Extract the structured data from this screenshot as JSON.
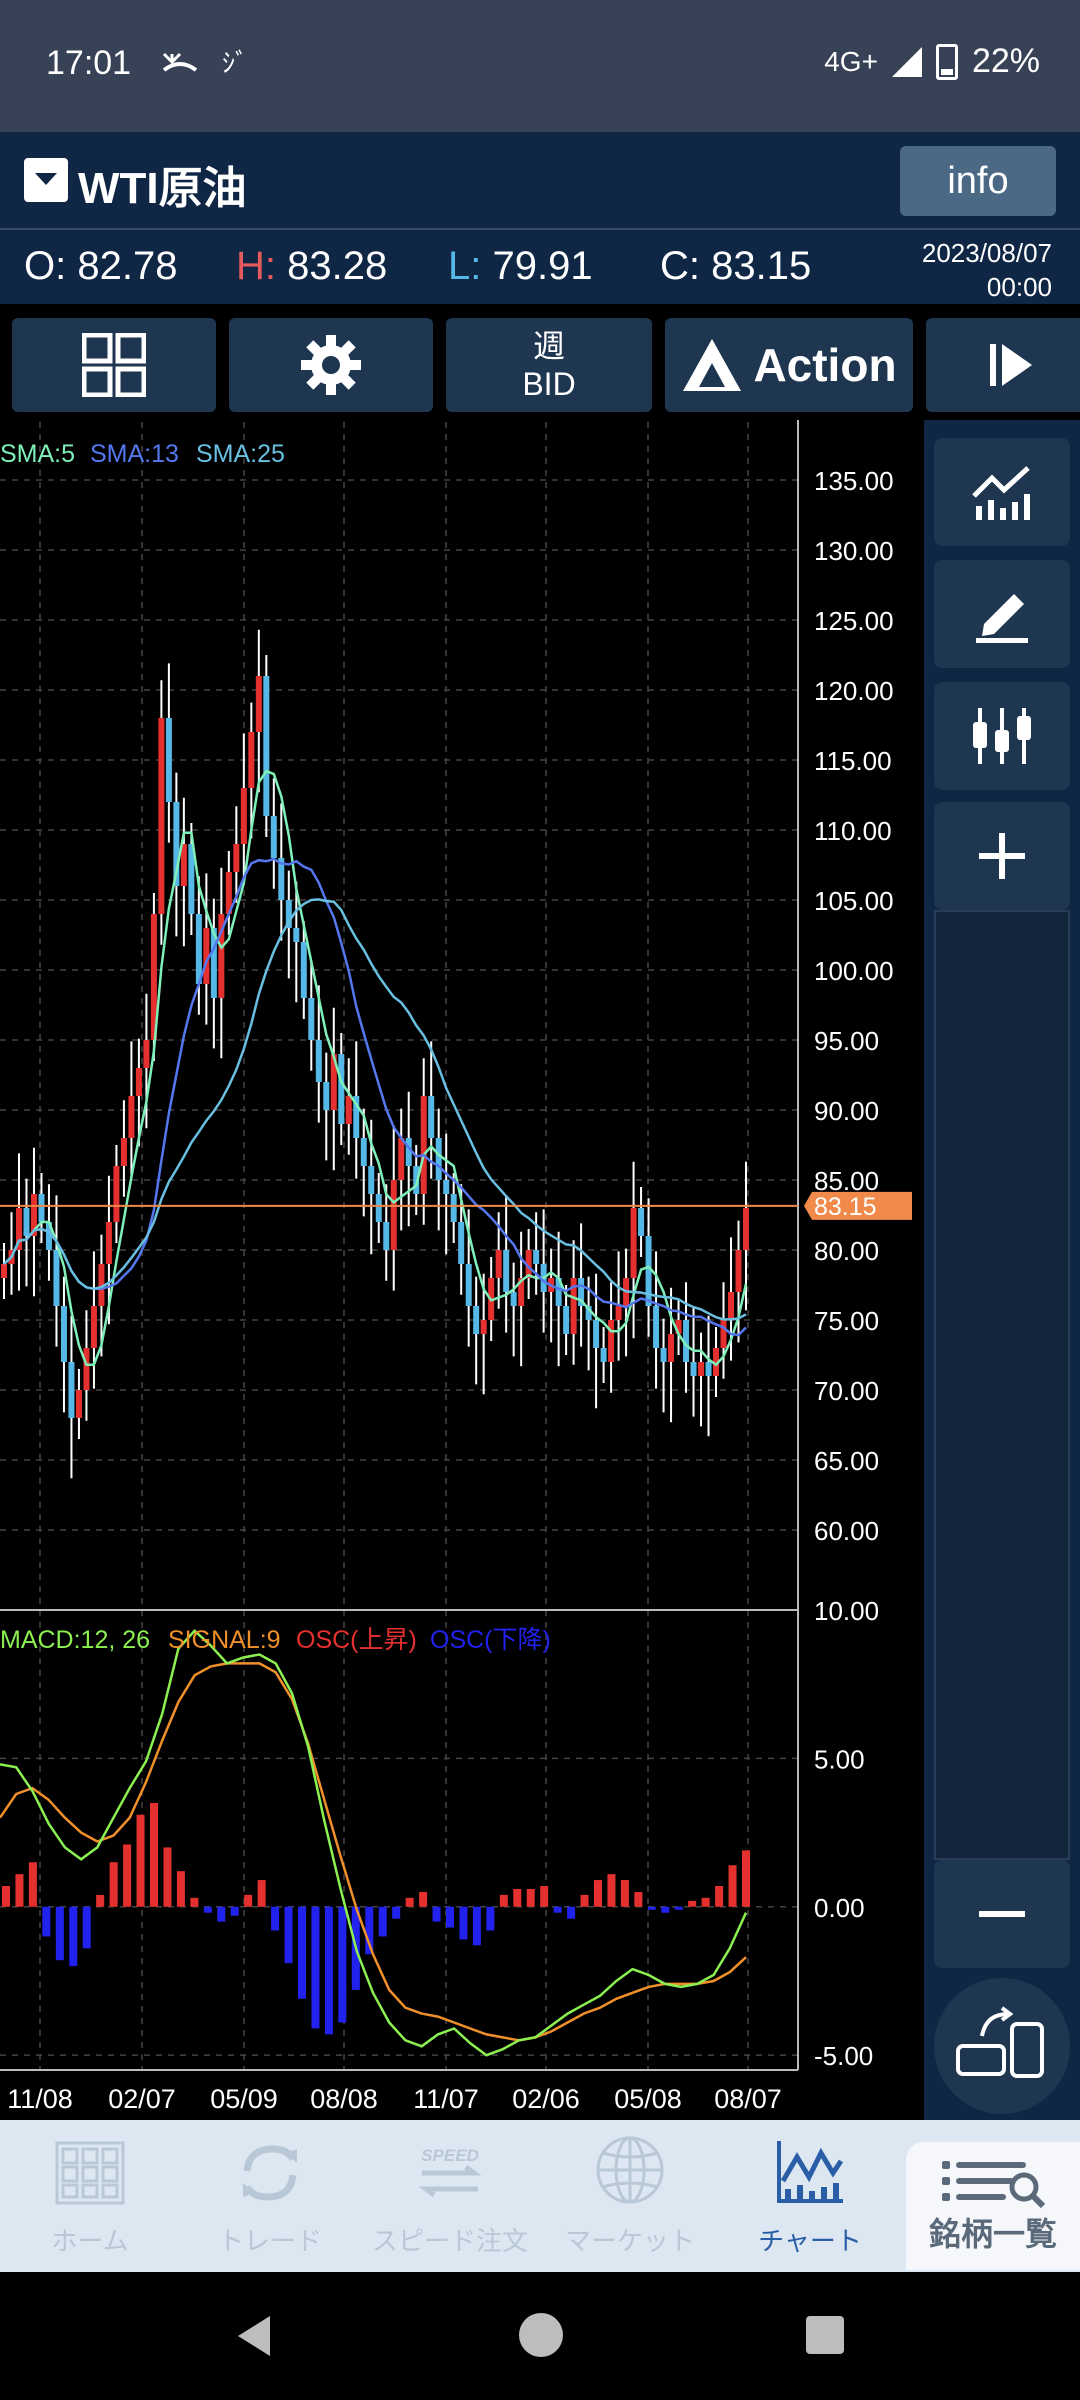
{
  "status": {
    "time": "17:01",
    "network": "4G+",
    "battery": "22%"
  },
  "header": {
    "title": "WTI原油",
    "info": "info",
    "o_label": "O:",
    "o": "82.78",
    "h_label": "H:",
    "h": "83.28",
    "l_label": "L:",
    "l": "79.91",
    "c_label": "C:",
    "c": "83.15",
    "date": "2023/08/07",
    "time": "00:00"
  },
  "toolbar": {
    "timeframe": "週",
    "price_side": "BID",
    "action": "Action"
  },
  "legend": {
    "sma5": "SMA:5",
    "sma13": "SMA:13",
    "sma25": "SMA:25",
    "macd": "MACD:12, 26",
    "signal": "SIGNAL:9",
    "osc_up": "OSC(上昇)",
    "osc_down": "OSC(下降)"
  },
  "current_price": "83.15",
  "nav": {
    "home": "ホーム",
    "trade": "トレード",
    "speed": "スピード注文",
    "speed_icon_text": "SPEED",
    "market": "マーケット",
    "chart": "チャート",
    "list": "銘柄一覧"
  },
  "colors": {
    "up": "#e53030",
    "down": "#56b8e6",
    "sma5": "#7ff0b8",
    "sma13": "#5577ee",
    "sma25": "#69bfe0",
    "macd": "#8cf050",
    "signal": "#f0902a",
    "price_line": "#f0894a",
    "osc_up": "#e53030",
    "osc_down": "#2222ee"
  },
  "chart_data": [
    {
      "type": "candlestick",
      "ylim": [
        55,
        137
      ],
      "y_ticks": [
        "135.00",
        "130.00",
        "125.00",
        "120.00",
        "115.00",
        "110.00",
        "105.00",
        "100.00",
        "95.00",
        "90.00",
        "85.00",
        "80.00",
        "75.00",
        "70.00",
        "65.00",
        "60.00"
      ],
      "x_ticks": [
        "11/08",
        "02/07",
        "05/09",
        "08/08",
        "11/07",
        "02/06",
        "05/08",
        "08/07"
      ],
      "closes": [
        79,
        80,
        83,
        81,
        84,
        82,
        80,
        76,
        72,
        68,
        70,
        73,
        76,
        79,
        82,
        86,
        88,
        91,
        93,
        95,
        104,
        118,
        112,
        106,
        109,
        104,
        99,
        103,
        98,
        104,
        107,
        109,
        113,
        117,
        121,
        111,
        108,
        105,
        103,
        102,
        98,
        95,
        92,
        90,
        94,
        89,
        91,
        88,
        86,
        84,
        82,
        80,
        85,
        88,
        86,
        84,
        91,
        88,
        85,
        84,
        82,
        79,
        76,
        74,
        75,
        78,
        80,
        77,
        76,
        78,
        80,
        79,
        77,
        78,
        76,
        74,
        78,
        76,
        75,
        73,
        72,
        75,
        76,
        78,
        83,
        81,
        76,
        73,
        72,
        74,
        75,
        72,
        71,
        72,
        71,
        73,
        75,
        77,
        80,
        83
      ],
      "sma5_end": 75.5,
      "sma13_end": 75.2,
      "sma25_end": 78.5
    },
    {
      "type": "macd",
      "ylim": [
        -5.5,
        10
      ],
      "y_ticks": [
        "10.00",
        "5.00",
        "0.00",
        "-5.00"
      ],
      "macd": [
        4.8,
        4.7,
        3.9,
        2.8,
        2.0,
        1.6,
        2.0,
        3.0,
        4.0,
        4.9,
        6.5,
        8.7,
        9.3,
        8.8,
        8.2,
        8.4,
        8.5,
        8.2,
        7.2,
        5.4,
        2.9,
        0.6,
        -1.5,
        -2.9,
        -3.9,
        -4.5,
        -4.7,
        -4.3,
        -4.1,
        -4.6,
        -5.0,
        -4.8,
        -4.5,
        -4.4,
        -4.0,
        -3.6,
        -3.3,
        -3.0,
        -2.5,
        -2.1,
        -2.3,
        -2.6,
        -2.7,
        -2.6,
        -2.3,
        -1.4,
        -0.2
      ],
      "signal": [
        3.0,
        3.8,
        4.0,
        3.6,
        3.0,
        2.5,
        2.2,
        2.4,
        3.0,
        4.2,
        5.6,
        6.9,
        7.8,
        8.1,
        8.2,
        8.2,
        8.2,
        7.9,
        7.0,
        5.5,
        3.6,
        1.7,
        -0.1,
        -1.6,
        -2.8,
        -3.4,
        -3.6,
        -3.7,
        -3.9,
        -4.1,
        -4.3,
        -4.4,
        -4.5,
        -4.4,
        -4.2,
        -3.9,
        -3.6,
        -3.4,
        -3.1,
        -2.9,
        -2.7,
        -2.6,
        -2.6,
        -2.6,
        -2.5,
        -2.2,
        -1.7
      ],
      "osc": [
        0.7,
        1.1,
        1.5,
        -1.0,
        -1.8,
        -2.0,
        -1.4,
        0.4,
        1.5,
        2.1,
        3.1,
        3.5,
        2.0,
        1.2,
        0.3,
        -0.2,
        -0.5,
        -0.3,
        0.4,
        0.9,
        -0.8,
        -1.9,
        -3.1,
        -4.1,
        -4.3,
        -3.9,
        -2.8,
        -1.6,
        -1.0,
        -0.4,
        0.3,
        0.5,
        -0.5,
        -0.7,
        -1.1,
        -1.3,
        -0.8,
        0.4,
        0.6,
        0.6,
        0.7,
        -0.2,
        -0.4,
        0.4,
        0.9,
        1.1,
        0.9,
        0.5,
        -0.1,
        -0.2,
        -0.1,
        0.2,
        0.3,
        0.7,
        1.4,
        1.9
      ]
    }
  ]
}
